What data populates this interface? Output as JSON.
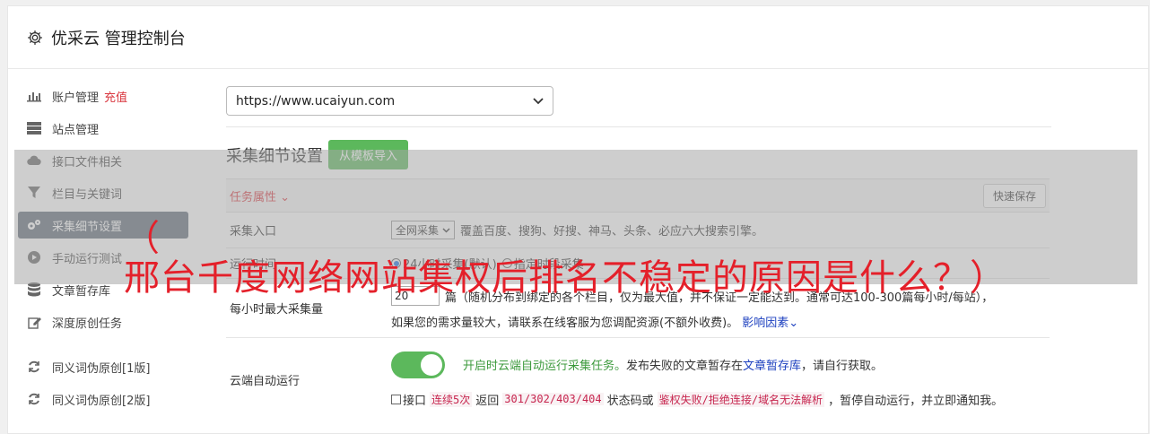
{
  "header": {
    "title": "优采云 管理控制台"
  },
  "sidebar": {
    "items": [
      {
        "label": "账户管理",
        "extra": "充值",
        "icon": "bar-chart-icon"
      },
      {
        "label": "站点管理",
        "icon": "server-icon"
      },
      {
        "label": "接口文件相关",
        "icon": "cloud-upload-icon"
      },
      {
        "label": "栏目与关键词",
        "icon": "filter-icon"
      },
      {
        "label": "采集细节设置",
        "icon": "gears-icon",
        "active": true
      },
      {
        "label": "手动运行测试",
        "icon": "play-circle-icon"
      },
      {
        "label": "文章暂存库",
        "icon": "database-icon"
      },
      {
        "label": "深度原创任务",
        "icon": "edit-icon"
      },
      {
        "label": "同义词伪原创[1版]",
        "icon": "refresh-icon"
      },
      {
        "label": "同义词伪原创[2版]",
        "icon": "refresh-icon"
      }
    ]
  },
  "main": {
    "site_select": "https://www.ucaiyun.com",
    "section_title": "采集细节设置",
    "import_button": "从模板导入",
    "task_attr": "任务属性 ⌄",
    "quick_save": "快速保存",
    "rows": {
      "entry": {
        "label": "采集入口",
        "select": "全网采集",
        "desc": "覆盖百度、搜狗、好搜、神马、头条、必应六大搜索引擎。"
      },
      "time": {
        "label": "运行时间",
        "opt1": "24小时采集(默认)",
        "opt2": "指定时段采集"
      },
      "max": {
        "label": "每小时最大采集量",
        "value": "20",
        "desc1": "篇（随机分布到绑定的各个栏目，仅为最大值，并不保证一定能达到。通常可达100-300篇每小时/每站），",
        "desc2": "如果您的需求量较大，请联系在线客服为您调配资源(不额外收费)。",
        "link": "影响因素⌄"
      },
      "cloud": {
        "label": "云端自动运行",
        "line1_green": "开启时云端自动运行采集任务。",
        "line1_rest": "发布失败的文章暂存在",
        "line1_link": "文章暂存库",
        "line1_tail": "，请自行获取。",
        "line2_a": "接口",
        "code1": "连续5次",
        "line2_b": "返回",
        "code2": "301/302/403/404",
        "line2_c": "状态码或",
        "code3": "鉴权失败/拒绝连接/域名无法解析",
        "line2_d": "，暂停自动运行，并立即通知我。"
      }
    }
  },
  "overlay": {
    "line1": "（",
    "line2": "邢台千度网络网站集权后排名不稳定的原因是什么？）"
  },
  "colors": {
    "accent_green": "#5cb85c",
    "active_nav": "#5f6b78",
    "red": "#d9363e",
    "link": "#1b3fbf"
  }
}
